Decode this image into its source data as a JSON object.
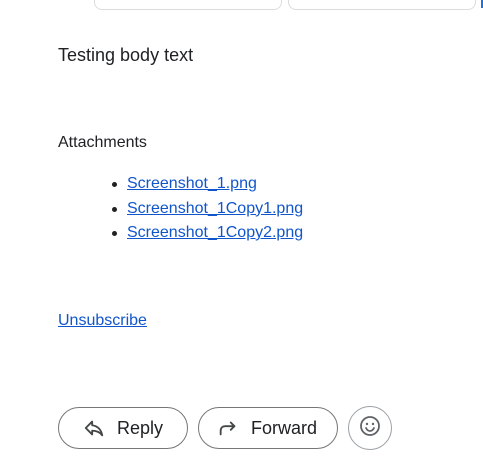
{
  "message": {
    "body_text": "Testing body text",
    "attachments_heading": "Attachments",
    "attachments": [
      {
        "name": "Screenshot_1.png"
      },
      {
        "name": "Screenshot_1Copy1.png"
      },
      {
        "name": "Screenshot_1Copy2.png"
      }
    ],
    "unsubscribe_label": "Unsubscribe"
  },
  "actions": {
    "reply_label": "Reply",
    "forward_label": "Forward",
    "reply_icon": "reply-arrow-icon",
    "forward_icon": "forward-arrow-icon",
    "emoji_icon": "smiley-icon"
  },
  "colors": {
    "link": "#1155cc",
    "text": "#202124",
    "border": "#747775"
  }
}
